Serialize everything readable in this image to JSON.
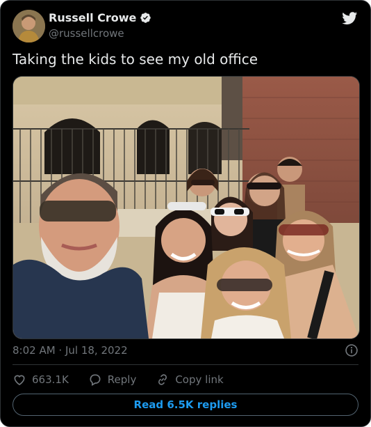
{
  "author": {
    "name": "Russell Crowe",
    "handle": "@russellcrowe",
    "verified": true,
    "avatar_icon": "user-avatar"
  },
  "tweet": {
    "text": "Taking the kids to see my old office",
    "timestamp": "8:02 AM · Jul 18, 2022"
  },
  "actions": {
    "likes": "663.1K",
    "reply_label": "Reply",
    "copy_link_label": "Copy link"
  },
  "read_replies_label": "Read 6.5K replies",
  "colors": {
    "background": "#000000",
    "text": "#e7e9ea",
    "muted": "#71767b",
    "accent": "#1d9bf0",
    "border": "#2f3336"
  }
}
